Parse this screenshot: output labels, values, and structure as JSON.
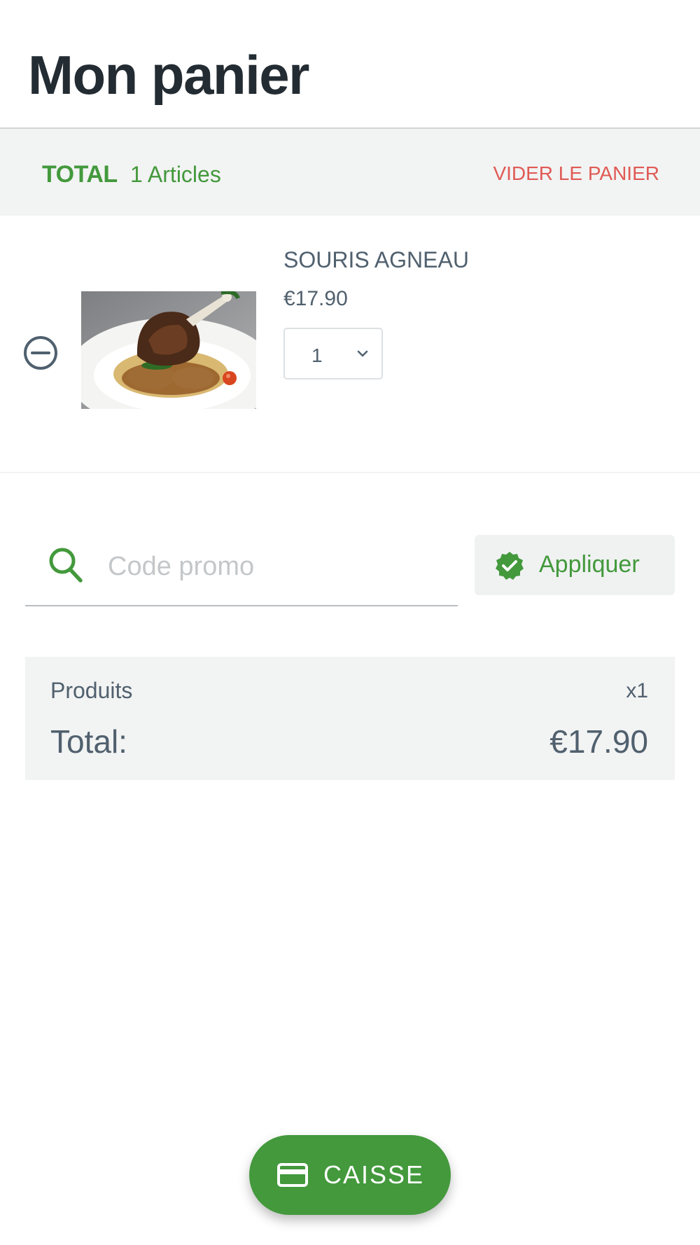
{
  "header": {
    "title": "Mon panier"
  },
  "cart_summary_bar": {
    "total_label": "TOTAL",
    "articles": "1 Articles",
    "empty_cart_label": "VIDER LE PANIER",
    "accent_color": "#43993c",
    "danger_color": "#e05a55"
  },
  "items": [
    {
      "name": "SOURIS AGNEAU",
      "price": "€17.90",
      "quantity": "1",
      "image": "lamb-shank-dish-photo"
    }
  ],
  "promo": {
    "placeholder": "Code promo",
    "value": "",
    "apply_label": "Appliquer"
  },
  "summary": {
    "products_label": "Produits",
    "products_count": "x1",
    "total_label": "Total:",
    "total_amount": "€17.90"
  },
  "checkout": {
    "label": "CAISSE",
    "icon": "credit-card-icon"
  }
}
